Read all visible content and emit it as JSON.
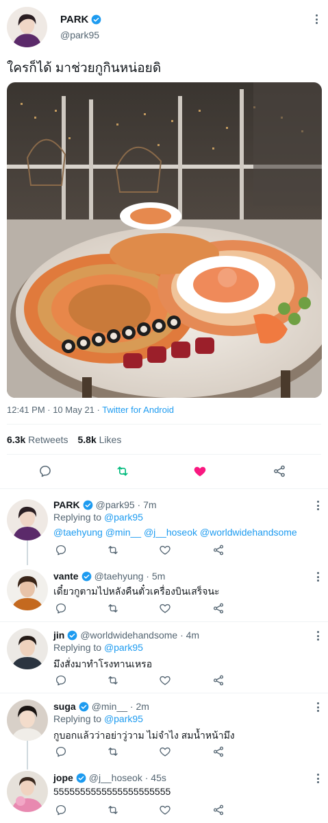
{
  "main_tweet": {
    "author_name": "PARK",
    "author_handle": "@park95",
    "text": "ใครก็ได้ มาช่วยกูกินหน่อยดิ",
    "time": "12:41 PM · 10 May 21 · ",
    "source": "Twitter for Android",
    "retweets_count": "6.3k",
    "retweets_label": "Retweets",
    "likes_count": "5.8k",
    "likes_label": "Likes",
    "liked": true,
    "retweet_color": "#00ba7c",
    "like_color": "#f91880"
  },
  "replies": [
    {
      "name": "PARK",
      "handle": "@park95",
      "time": "7m",
      "replying_label": "Replying to ",
      "replying_to": "@park95",
      "mentions": "@taehyung @min__ @j__hoseok @worldwidehandsome"
    },
    {
      "name": "vante",
      "handle": "@taehyung",
      "time": "5m",
      "text": "เดี๋ยวกูตามไปหลังคืนตั๋วเครื่องบินเสร็จนะ"
    },
    {
      "name": "jin",
      "handle": "@worldwidehandsome",
      "time": "4m",
      "replying_label": "Replying to ",
      "replying_to": "@park95",
      "text": "มึงสั่งมาทำโรงทานเหรอ"
    },
    {
      "name": "suga",
      "handle": "@min__",
      "time": "2m",
      "replying_label": "Replying to ",
      "replying_to": "@park95",
      "text": "กูบอกแล้วว่าอย่าวู่วาม ไม่จำไง สมน้ำหน้ามึง"
    },
    {
      "name": "jope",
      "handle": "@j__hoseok",
      "time": "45s",
      "text": "5555555555555555555555"
    }
  ],
  "icons": {
    "reply": "reply-icon",
    "retweet": "retweet-icon",
    "like": "heart-icon",
    "share": "share-icon",
    "verified": "verified-badge-icon",
    "more": "more-options-icon"
  },
  "colors": {
    "link": "#1d9bf0",
    "secondary_text": "#536471"
  }
}
